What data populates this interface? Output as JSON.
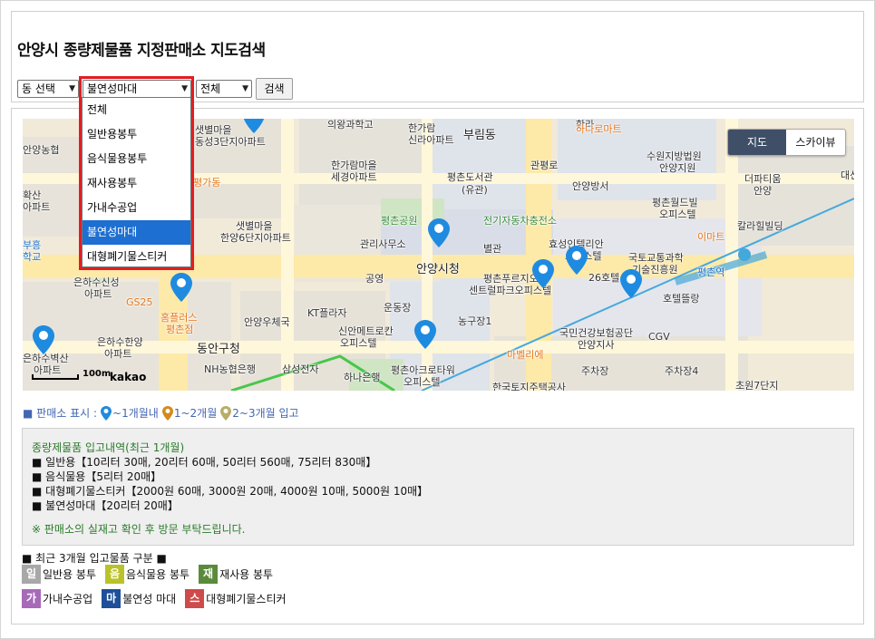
{
  "header": {
    "title": "안양시 종량제물품 지정판매소 지도검색",
    "dong_select": "동 선택",
    "item_select": "불연성마대",
    "period_select": "전체",
    "search_label": "검색"
  },
  "dropdown": {
    "options": [
      "전체",
      "일반용봉투",
      "음식물용봉투",
      "재사용봉투",
      "가내수공업",
      "불연성마대",
      "대형폐기물스티커"
    ],
    "selected_index": 5
  },
  "map": {
    "type_map": "지도",
    "type_skyview": "스카이뷰",
    "scale_text": "100m",
    "logo": "kakao",
    "labels": {
      "l01": "의왕과학고",
      "l02": "한라",
      "l03": "하나로마트",
      "l04": "한가람",
      "l05": "신라아파트",
      "l06": "부림동",
      "l07": "샛별마을",
      "l08": "동성3단지아파트",
      "l09": "안양농협",
      "l10": "한가람마을",
      "l11": "세경아파트",
      "l12": "평촌도서관",
      "l13": "(유관)",
      "l14": "관평로",
      "l15": "수원지방법원",
      "l16": "안양지원",
      "l17": "더파티움",
      "l18": "안양",
      "l19": "대선",
      "l20": "확산",
      "l21": "아파트",
      "l22": "안양방서",
      "l23": "평촌월드빌",
      "l24": "오피스텔",
      "l25": "평촌공원",
      "l26": "전기자동차충전소",
      "l27": "샛별마을",
      "l28": "한양6단지아파트",
      "l29": "부흥",
      "l30": "학교",
      "l31": "관리사무소",
      "l32": "별관",
      "l33": "효성인텔리안",
      "l34": "오피스텔",
      "l35": "국토교통과학",
      "l36": "기술진흥원",
      "l37": "이마트",
      "l38": "칼라힐빌딩",
      "l39": "평촌역",
      "l40": "은하수신성",
      "l41": "아파트",
      "l42": "공영",
      "l43": "안양시청",
      "l44": "평촌푸르지오",
      "l45": "센트럴파크오피스텔",
      "l46": "26호텔",
      "l47": "호텔뜰랑",
      "l48": "GS25",
      "l49": "홈플러스",
      "l50": "평촌점",
      "l51": "KT플라자",
      "l52": "운동장",
      "l53": "농구장1",
      "l54": "국민건강보험공단",
      "l55": "안양지사",
      "l56": "CGV",
      "l57": "은하수한양",
      "l58": "아파트",
      "l59": "안양우체국",
      "l60": "신안메트로칸",
      "l61": "오피스텔",
      "l62": "마벨리에",
      "l63": "은하수벽산",
      "l64": "아파트",
      "l65": "동안구청",
      "l66": "NH농협은행",
      "l67": "삼성전자",
      "l68": "하나은행",
      "l69": "평촌아크로타워",
      "l70": "오피스텔",
      "l71": "주차장",
      "l72": "주차장4",
      "l73": "초원7단지",
      "l74": "한국토지주택공사",
      "l75": "평가동"
    }
  },
  "legend": {
    "prefix": "■ 판매소 표시 :",
    "p1": "~1개월내",
    "p2": "1~2개월",
    "p3": "2~3개월 입고"
  },
  "info": {
    "title": "종량제물품 입고내역(최근 1개월)",
    "lines": [
      "■ 일반용【10리터 30매, 20리터 60매, 50리터 560매, 75리터 830매】",
      "■ 음식물용【5리터 20매】",
      "■ 대형폐기물스티커【2000원 60매, 3000원 20매, 4000원 10매, 5000원 10매】",
      "■ 불연성마대【20리터 20매】"
    ]
  },
  "notice": "※ 판매소의 실재고 확인 후 방문 부탁드립니다.",
  "categories": {
    "title": "■ 최근 3개월 입고물품 구분 ■",
    "items": [
      {
        "badge": "일",
        "label": "일반용 봉투",
        "color": "#a8a8a8"
      },
      {
        "badge": "음",
        "label": "음식물용 봉투",
        "color": "#b9c22a"
      },
      {
        "badge": "재",
        "label": "재사용 봉투",
        "color": "#5b8a3c"
      },
      {
        "badge": "가",
        "label": "가내수공업",
        "color": "#a76ab8"
      },
      {
        "badge": "마",
        "label": "불연성 마대",
        "color": "#1e4f98"
      },
      {
        "badge": "스",
        "label": "대형폐기물스티커",
        "color": "#cf4a4a"
      }
    ]
  },
  "colors": {
    "pin_recent": "#1f8be0",
    "pin_mid": "#d48a1a",
    "pin_old": "#b8ad6a",
    "highlight": "#e31d23",
    "selected": "#1d6fd1"
  }
}
